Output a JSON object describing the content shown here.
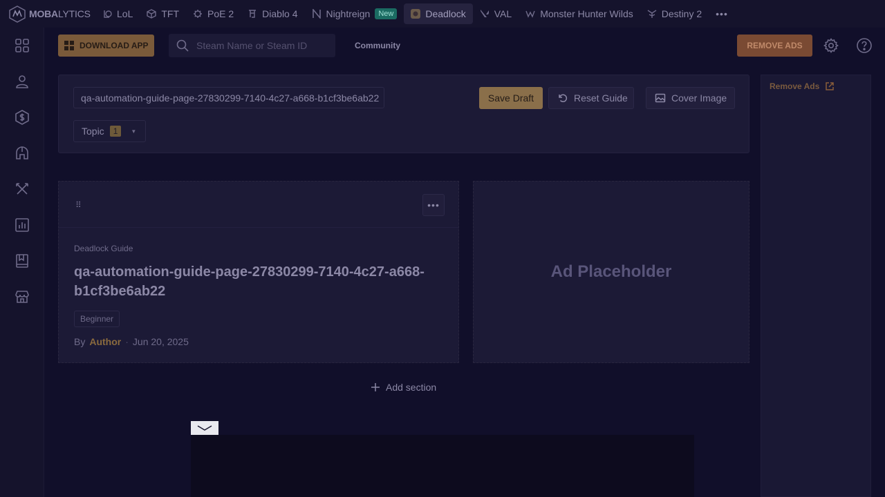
{
  "brand": {
    "name_bold": "MOBA",
    "name_rest": "LYTICS"
  },
  "games": [
    {
      "label": "LoL",
      "icon": "lol-icon"
    },
    {
      "label": "TFT",
      "icon": "tft-icon"
    },
    {
      "label": "PoE 2",
      "icon": "poe2-icon"
    },
    {
      "label": "Diablo 4",
      "icon": "diablo-icon"
    },
    {
      "label": "Nightreign",
      "icon": "nightreign-icon",
      "badge": "New"
    },
    {
      "label": "Deadlock",
      "icon": "deadlock-icon",
      "active": true
    },
    {
      "label": "VAL",
      "icon": "valorant-icon"
    },
    {
      "label": "Monster Hunter Wilds",
      "icon": "mhw-icon"
    },
    {
      "label": "Destiny 2",
      "icon": "destiny-icon"
    }
  ],
  "header": {
    "download_label": "DOWNLOAD APP",
    "search_placeholder": "Steam Name or Steam ID",
    "community_label": "Community",
    "remove_ads_label": "REMOVE ADS"
  },
  "editor": {
    "title_value": "qa-automation-guide-page-27830299-7140-4c27-a668-b1cf3be6ab22",
    "topic_label": "Topic",
    "topic_count": "1",
    "save_draft_label": "Save Draft",
    "reset_label": "Reset Guide",
    "cover_label": "Cover Image"
  },
  "section": {
    "guide_label": "Deadlock Guide",
    "title": "qa-automation-guide-page-27830299-7140-4c27-a668-b1cf3be6ab22",
    "level": "Beginner",
    "by": "By",
    "author": "Author",
    "date": "Jun 20, 2025"
  },
  "ad_placeholder": "Ad Placeholder",
  "add_section_label": "Add section",
  "rail": {
    "remove_ads_label": "Remove Ads"
  },
  "colors": {
    "accent": "#8a6f4a",
    "background": "#110f2a",
    "panel": "#1c1a36"
  }
}
